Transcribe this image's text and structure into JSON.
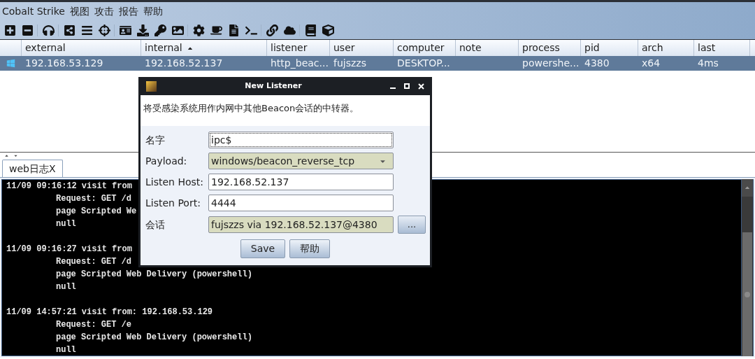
{
  "menu": [
    "Cobalt Strike",
    "视图",
    "攻击",
    "报告",
    "帮助"
  ],
  "table": {
    "columns": [
      {
        "label": "external",
        "sorted": false
      },
      {
        "label": "internal",
        "sorted": true
      },
      {
        "label": "listener",
        "sorted": false
      },
      {
        "label": "user",
        "sorted": false
      },
      {
        "label": "computer",
        "sorted": false
      },
      {
        "label": "note",
        "sorted": false
      },
      {
        "label": "process",
        "sorted": false
      },
      {
        "label": "pid",
        "sorted": false
      },
      {
        "label": "arch",
        "sorted": false
      },
      {
        "label": "last",
        "sorted": false
      }
    ],
    "rows": [
      {
        "selected": true,
        "cells": [
          "192.168.53.129",
          "192.168.52.137",
          "http_beac...",
          "fujszzs",
          "DESKTOP...",
          "",
          "powershe...",
          "4380",
          "x64",
          "4ms"
        ]
      }
    ]
  },
  "tabs": [
    {
      "label": "web日志X",
      "selected": true
    }
  ],
  "log": [
    {
      "time": "11/09 09:16:12",
      "text": "visit from",
      "lines": [
        "Request: GET /d",
        "page Scripted We",
        "null"
      ]
    },
    {
      "time": "11/09 09:16:27",
      "text": "visit from",
      "lines": [
        "Request: GET /d",
        "page Scripted Web Delivery (powershell)",
        "null"
      ]
    },
    {
      "time": "11/09 14:57:21",
      "text": "visit from: 192.168.53.129",
      "lines": [
        "Request: GET /e",
        "page Scripted Web Delivery (powershell)",
        "null"
      ]
    }
  ],
  "dialog": {
    "title": "New Listener",
    "description": "将受感染系统用作内网中其他Beacon会话的中转器。",
    "fields": [
      {
        "kind": "text",
        "label": "名字",
        "value": "ipc$",
        "focused": true
      },
      {
        "kind": "combo",
        "label": "Payload:",
        "value": "windows/beacon_reverse_tcp",
        "focused": false
      },
      {
        "kind": "text",
        "label": "Listen Host:",
        "value": "192.168.52.137",
        "focused": false
      },
      {
        "kind": "text",
        "label": "Listen Port:",
        "value": "4444",
        "focused": false
      },
      {
        "kind": "session",
        "label": "会话",
        "value": "fujszzs via  192.168.52.137@4380",
        "button": "...",
        "focused": false
      }
    ],
    "buttons": [
      "Save",
      "帮助"
    ]
  }
}
